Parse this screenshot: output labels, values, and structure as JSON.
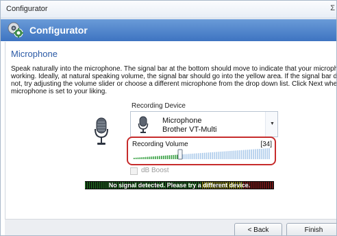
{
  "window": {
    "title": "Configurator",
    "close_glyph": "Σ"
  },
  "header": {
    "title": "Configurator",
    "icon": "webcam-gear-icon"
  },
  "section": {
    "title": "Microphone"
  },
  "description": {
    "lines": [
      "Speak naturally into the microphone. The signal bar at the bottom should move to indicate that your microphone is",
      "working. Ideally, at natural speaking volume, the signal bar should go into the yellow area. If the signal bar does",
      "not, try adjusting the volume slider or choose a different microphone from the drop down list. Click Next when the",
      "microphone is set to your liking."
    ]
  },
  "recording_device": {
    "label": "Recording Device",
    "selected_name": "Microphone",
    "selected_detail": "Brother VT-Multi",
    "icon": "microphone-icon"
  },
  "recording_volume": {
    "label": "Recording Volume",
    "value_text": "[34]",
    "value": 34,
    "max": 100
  },
  "db_boost": {
    "label": "dB Boost",
    "checked": false,
    "enabled": false
  },
  "signal": {
    "message": "No signal detected. Please try a different device."
  },
  "buttons": {
    "back": "< Back",
    "finish": "Finish"
  },
  "colors": {
    "header": "#3e74c1",
    "section_title": "#2b5aa6",
    "highlight": "#c62b2b",
    "volume_fill": "#2e9c3a"
  }
}
